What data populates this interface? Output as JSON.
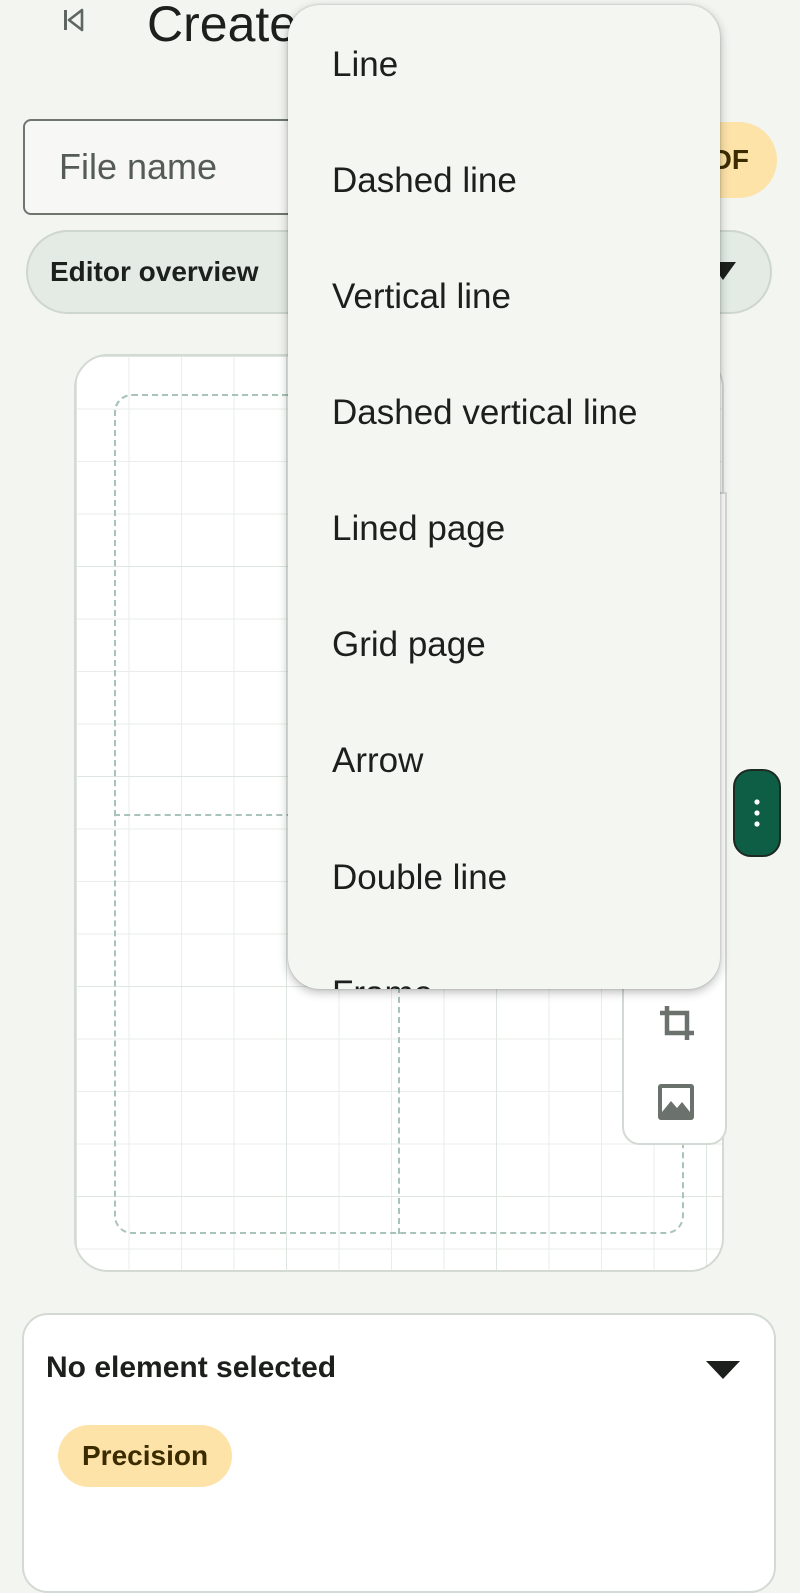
{
  "header": {
    "back_icon": "first-page-icon",
    "title": "Create"
  },
  "file_name": {
    "placeholder": "File name",
    "value": ""
  },
  "pdf_chip": {
    "label": "DF"
  },
  "overview": {
    "label": "Editor overview"
  },
  "shape_menu": {
    "items": [
      "Line",
      "Dashed line",
      "Vertical line",
      "Dashed vertical line",
      "Lined page",
      "Grid page",
      "Arrow",
      "Double line",
      "Frame"
    ]
  },
  "side_tools": {
    "icons": [
      "crop-icon",
      "image-icon"
    ]
  },
  "fab": {
    "icon": "more-vert-icon"
  },
  "bottom_card": {
    "title": "No element selected",
    "chip": "Precision"
  },
  "colors": {
    "background": "#f3f5f1",
    "accent_green": "#0e5e45",
    "chip_yellow": "#fde3a8",
    "overview_bg": "#e3ebe4",
    "guide_dashed": "#a8c3b8"
  }
}
